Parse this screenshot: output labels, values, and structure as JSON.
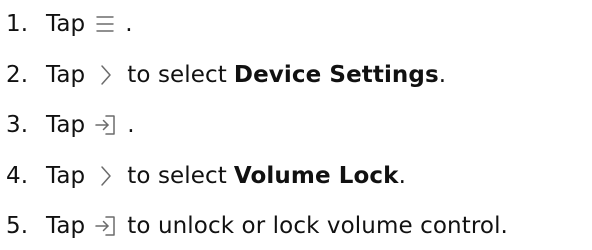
{
  "steps": [
    {
      "number": "1.",
      "tap": "Tap",
      "icon": "menu-icon",
      "after": ".",
      "bold": "",
      "end": ""
    },
    {
      "number": "2.",
      "tap": "Tap",
      "icon": "chevron-right-icon",
      "after": "to select",
      "bold": "Device Settings",
      "end": "."
    },
    {
      "number": "3.",
      "tap": "Tap",
      "icon": "enter-icon",
      "after": ".",
      "bold": "",
      "end": ""
    },
    {
      "number": "4.",
      "tap": "Tap",
      "icon": "chevron-right-icon",
      "after": "to select",
      "bold": "Volume Lock",
      "end": "."
    },
    {
      "number": "5.",
      "tap": "Tap",
      "icon": "enter-icon",
      "after": "to unlock or lock volume control.",
      "bold": "",
      "end": ""
    }
  ]
}
